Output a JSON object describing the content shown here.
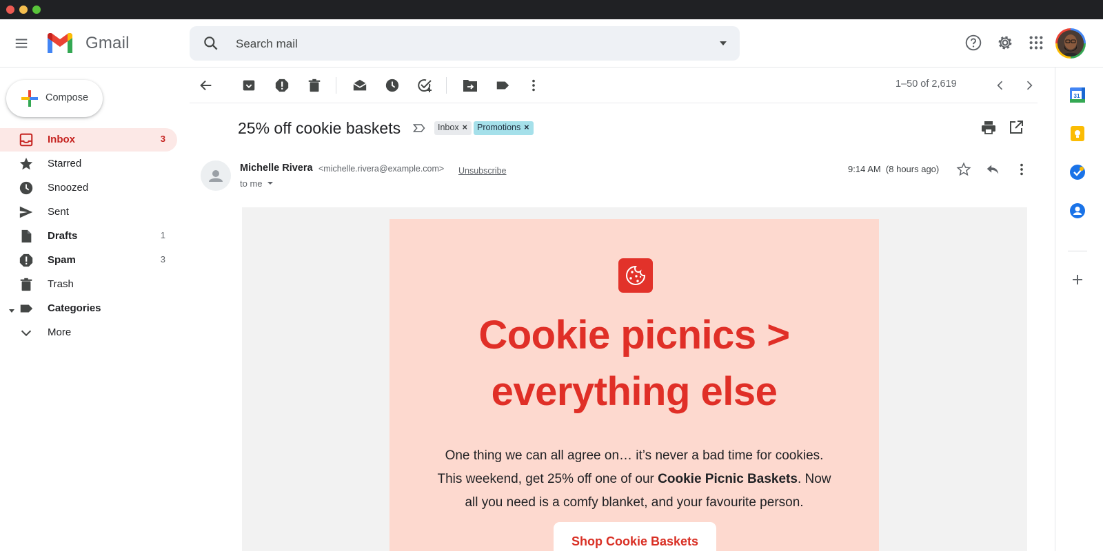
{
  "app": {
    "name": "Gmail"
  },
  "search": {
    "placeholder": "Search mail"
  },
  "sidebar": {
    "compose_label": "Compose",
    "items": [
      {
        "label": "Inbox",
        "count": "3"
      },
      {
        "label": "Starred",
        "count": ""
      },
      {
        "label": "Snoozed",
        "count": ""
      },
      {
        "label": "Sent",
        "count": ""
      },
      {
        "label": "Drafts",
        "count": "1"
      },
      {
        "label": "Spam",
        "count": "3"
      },
      {
        "label": "Trash",
        "count": ""
      },
      {
        "label": "Categories",
        "count": ""
      },
      {
        "label": "More",
        "count": ""
      }
    ]
  },
  "toolbar": {
    "pager": "1–50 of 2,619"
  },
  "message": {
    "subject": "25% off cookie baskets",
    "labels": [
      "Inbox",
      "Promotions"
    ],
    "sender_name": "Michelle Rivera",
    "sender_email": "<michelle.rivera@example.com>",
    "unsubscribe": "Unsubscribe",
    "to": "to me",
    "time": "9:14 AM  (8 hours ago)"
  },
  "email": {
    "headline_line1": "Cookie picnics >",
    "headline_line2": "everything else",
    "body_line1": "One thing we can all agree on… it’s never a bad time for cookies.",
    "body_line2_pre": "This weekend, get 25% off one of our ",
    "body_line2_bold": "Cookie Picnic Baskets",
    "body_line2_post": ". Now",
    "body_line3": "all you need is a comfy blanket, and your favourite person.",
    "cta": "Shop Cookie Baskets"
  },
  "side_panel": {
    "calendar_day": "31"
  },
  "colors": {
    "brand_red": "#e02f27",
    "card_bg": "#fdd9cf",
    "inbox_active_bg": "#fce8e6",
    "promotions_chip": "#a5e0ea"
  },
  "icons": [
    "menu-icon",
    "gmail-logo",
    "search-icon",
    "help-icon",
    "gear-icon",
    "apps-icon",
    "back-arrow-icon",
    "archive-icon",
    "report-spam-icon",
    "delete-icon",
    "mark-unread-icon",
    "snooze-icon",
    "add-task-icon",
    "move-to-icon",
    "label-icon",
    "more-vert-icon",
    "chevron-left-icon",
    "chevron-right-icon",
    "print-icon",
    "open-in-new-icon",
    "star-icon",
    "reply-icon",
    "calendar-icon",
    "keep-icon",
    "tasks-icon",
    "contacts-icon",
    "plus-icon",
    "cookie-icon"
  ]
}
